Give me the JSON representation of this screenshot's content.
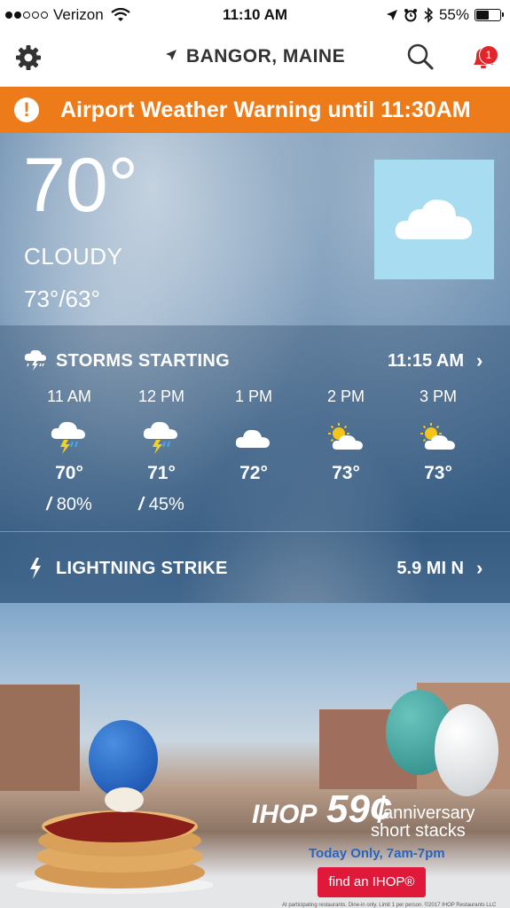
{
  "status_bar": {
    "carrier": "Verizon",
    "time": "11:10 AM",
    "battery": "55%",
    "battery_level": 0.55,
    "signal_bars": 2
  },
  "header": {
    "location": "BANGOR, MAINE",
    "notification_count": "1",
    "icons": [
      "gear-icon",
      "location-arrow-icon",
      "search-icon",
      "bell-icon"
    ]
  },
  "alert": {
    "text": "Airport Weather Warning until 11:30AM",
    "icon": "!",
    "color": "#ee7b19"
  },
  "current": {
    "temp": "70°",
    "condition": "CLOUDY",
    "hi_lo": "73°/63°",
    "icon": "cloud-icon"
  },
  "storm_row": {
    "title": "STORMS STARTING",
    "time": "11:15 AM",
    "icon": "storm-icon"
  },
  "hourly": [
    {
      "time": "11 AM",
      "temp": "70°",
      "precip": "80%",
      "icon": "thunderstorm-icon"
    },
    {
      "time": "12 PM",
      "temp": "71°",
      "precip": "45%",
      "icon": "thunderstorm-icon"
    },
    {
      "time": "1 PM",
      "temp": "72°",
      "precip": "",
      "icon": "cloud-icon"
    },
    {
      "time": "2 PM",
      "temp": "73°",
      "precip": "",
      "icon": "partly-sunny-icon"
    },
    {
      "time": "3 PM",
      "temp": "73°",
      "precip": "",
      "icon": "partly-sunny-icon"
    }
  ],
  "lightning_row": {
    "title": "LIGHTNING STRIKE",
    "distance": "5.9 MI N",
    "icon": "lightning-icon"
  },
  "ad": {
    "brand": "IHOP",
    "price": "59¢",
    "line1": "anniversary",
    "line2": "short stacks",
    "today": "Today Only, 7am-7pm",
    "button": "find an IHOP®",
    "fine_print": "At participating restaurants. Dine-in only. Limit 1 per person. ©2017 IHOP Restaurants LLC"
  }
}
